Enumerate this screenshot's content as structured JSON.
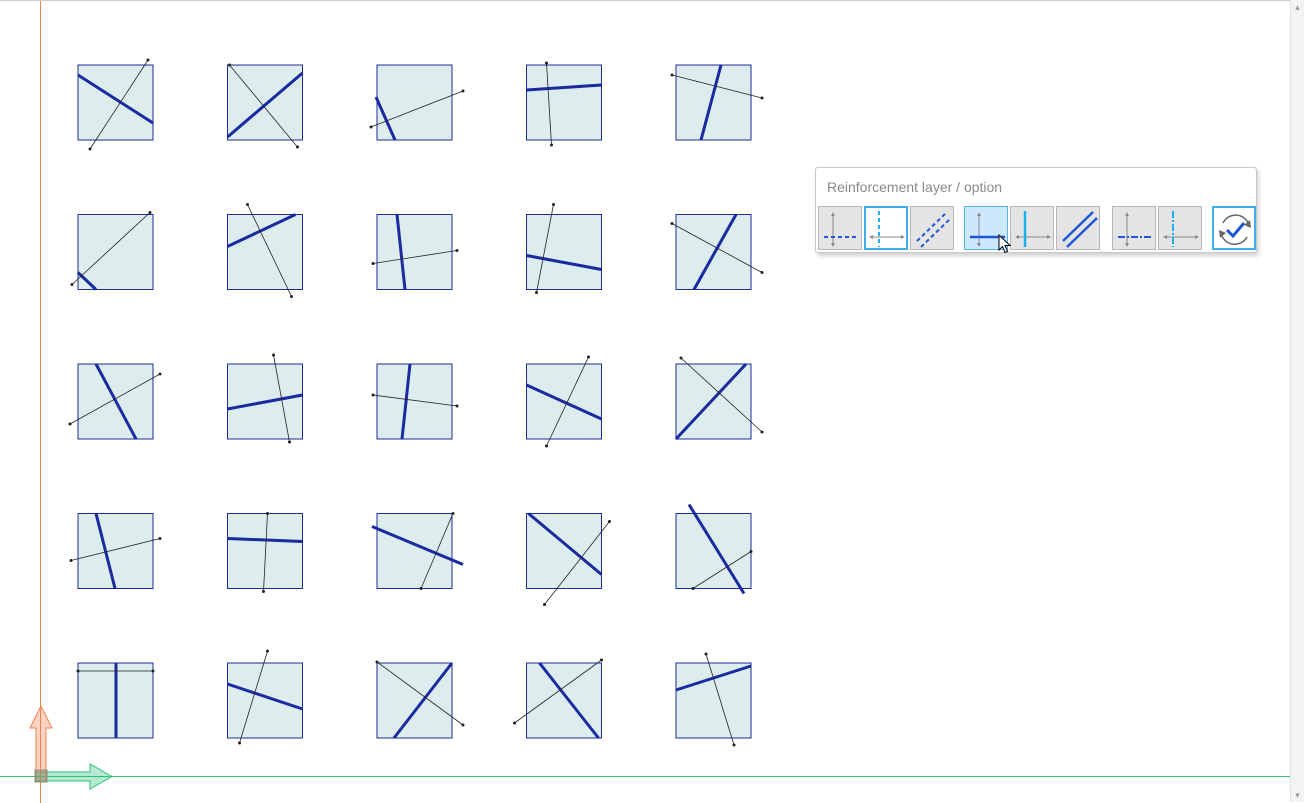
{
  "option_bar": {
    "title": "Reinforcement layer / option",
    "buttons": [
      {
        "name": "layer-bottom-horizontal",
        "state": "normal"
      },
      {
        "name": "layer-vertical-dashed",
        "state": "selected"
      },
      {
        "name": "layer-diagonal-dashed",
        "state": "normal"
      },
      {
        "name": "layer-bottom-horizontal-solid",
        "state": "hover"
      },
      {
        "name": "layer-vertical-solid",
        "state": "normal"
      },
      {
        "name": "layer-diagonal-solid",
        "state": "normal"
      },
      {
        "name": "layer-dashdot-horizontal",
        "state": "normal"
      },
      {
        "name": "layer-dashdot-vertical",
        "state": "normal"
      },
      {
        "name": "apply-confirm",
        "state": "active"
      }
    ]
  },
  "panels": {
    "rows": 5,
    "cols": 5,
    "colors": {
      "panel_fill": "#ddecec",
      "panel_border": "#1c2c9a",
      "thick_line": "#1a2aa0",
      "thin_line": "#222222",
      "origin_v_axis": "#f08050",
      "origin_h_axis": "#2ec07a"
    }
  },
  "colors": {
    "accent": "#3ab0f0",
    "icon_blue": "#1f57d8",
    "icon_gray": "#8a8a8a"
  }
}
